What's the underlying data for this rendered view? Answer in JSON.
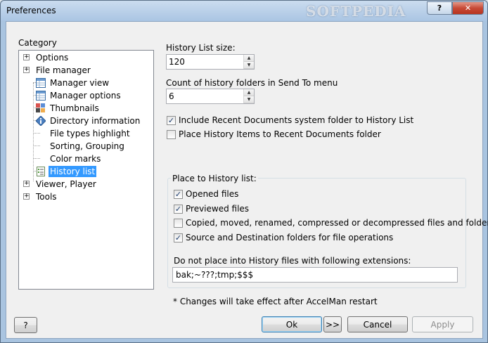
{
  "window": {
    "title": "Preferences",
    "watermark": "SOFTPEDIA",
    "help_glyph": "?",
    "close_glyph": "✕"
  },
  "category": {
    "label": "Category",
    "items": [
      {
        "label": "Options",
        "expandable": true,
        "icon": "none"
      },
      {
        "label": "File manager",
        "expandable": true,
        "icon": "none"
      },
      {
        "label": "Manager view",
        "icon": "grid-view-icon"
      },
      {
        "label": "Manager options",
        "icon": "grid-options-icon"
      },
      {
        "label": "Thumbnails",
        "icon": "thumbnails-icon"
      },
      {
        "label": "Directory information",
        "icon": "info-icon"
      },
      {
        "label": "File types highlight",
        "icon": "none"
      },
      {
        "label": "Sorting, Grouping",
        "icon": "none"
      },
      {
        "label": "Color marks",
        "icon": "none"
      },
      {
        "label": "History list",
        "icon": "history-list-icon",
        "selected": true
      },
      {
        "label": "Viewer, Player",
        "expandable": true,
        "icon": "none"
      },
      {
        "label": "Tools",
        "expandable": true,
        "icon": "none"
      }
    ],
    "expander_glyph": "+"
  },
  "history": {
    "size_label": "History List size:",
    "size_value": "120",
    "sendto_label": "Count of history folders in Send To menu",
    "sendto_value": "6",
    "include_recent_label": "Include Recent Documents system folder to History List",
    "include_recent_checked": true,
    "place_items_label": "Place History Items to Recent Documents folder",
    "place_items_checked": false,
    "group_title": "Place to History list:",
    "opened_label": "Opened files",
    "opened_checked": true,
    "previewed_label": "Previewed files",
    "previewed_checked": true,
    "copied_label": "Copied, moved, renamed, compressed or decompressed files and folders",
    "copied_checked": false,
    "source_dest_label": "Source and Destination folders for file operations",
    "source_dest_checked": true,
    "exclude_label": "Do not place into History files with following extensions:",
    "exclude_value": "bak;~???;tmp;$$$",
    "restart_note": "* Changes will take effect after AccelMan restart"
  },
  "buttons": {
    "help": "?",
    "ok": "Ok",
    "more": ">>",
    "cancel": "Cancel",
    "apply": "Apply"
  },
  "spin_up": "▲",
  "spin_down": "▼",
  "check_glyph": "✓"
}
